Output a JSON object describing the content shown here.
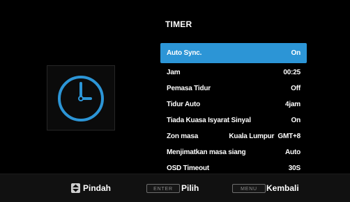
{
  "menu": {
    "title": "TIMER",
    "items": [
      {
        "label": "Auto Sync.",
        "value": "On",
        "selected": true
      },
      {
        "label": "Jam",
        "value": "00:25"
      },
      {
        "label": "Pemasa Tidur",
        "value": "Off"
      },
      {
        "label": "Tidur Auto",
        "value": "4jam"
      },
      {
        "label": "Tiada Kuasa Isyarat Sinyal",
        "value": "On"
      },
      {
        "label": "Zon masa",
        "value": "Kuala Lumpur  GMT+8"
      },
      {
        "label": "Menjimatkan masa siang",
        "value": "Auto"
      },
      {
        "label": "OSD Timeout",
        "value": "30S"
      }
    ]
  },
  "clock": {
    "icon": "clock-icon",
    "color": "#2c95d6"
  },
  "footer": {
    "move_label": "Pindah",
    "enter_key": "ENTER",
    "select_label": "Pilih",
    "menu_key": "MENU",
    "back_label": "Kembali"
  },
  "colors": {
    "accent": "#2c95d6",
    "background": "#000000",
    "footer": "#111111"
  }
}
